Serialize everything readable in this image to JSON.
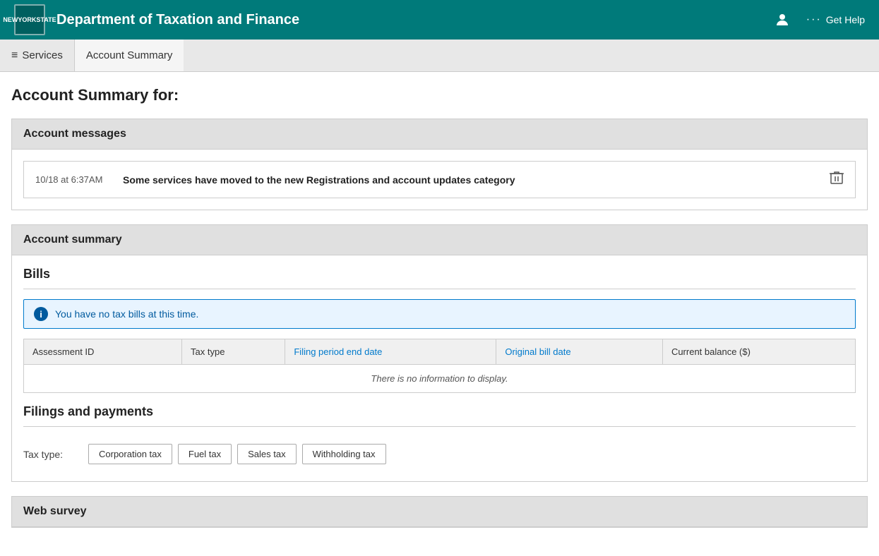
{
  "header": {
    "logo_line1": "NEW",
    "logo_line2": "YORK",
    "logo_line3": "STATE",
    "title": "Department of Taxation and Finance",
    "get_help_label": "Get Help",
    "user_icon": "👤"
  },
  "breadcrumb": {
    "services_label": "Services",
    "current_label": "Account Summary",
    "hamburger": "≡"
  },
  "page": {
    "title": "Account Summary for:"
  },
  "account_messages": {
    "section_header": "Account messages",
    "message": {
      "time": "10/18 at 6:37AM",
      "text": "Some services have moved to the new Registrations and account updates category"
    }
  },
  "account_summary": {
    "section_header": "Account summary",
    "bills": {
      "title": "Bills",
      "info_message": "You have no tax bills at this time.",
      "table": {
        "columns": [
          {
            "label": "Assessment ID",
            "link": false
          },
          {
            "label": "Tax type",
            "link": false
          },
          {
            "label": "Filing period end date",
            "link": true
          },
          {
            "label": "Original bill date",
            "link": true
          },
          {
            "label": "Current balance ($)",
            "link": false
          }
        ],
        "empty_message": "There is no information to display."
      }
    },
    "filings_payments": {
      "title": "Filings and payments",
      "tax_type_label": "Tax type:",
      "tax_types": [
        {
          "label": "Corporation tax"
        },
        {
          "label": "Fuel tax"
        },
        {
          "label": "Sales tax"
        },
        {
          "label": "Withholding tax"
        }
      ]
    }
  },
  "web_survey": {
    "section_header": "Web survey"
  }
}
